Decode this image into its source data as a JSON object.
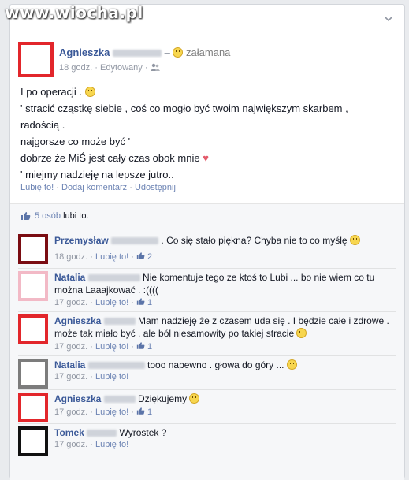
{
  "watermark": "www.wiocha.pl",
  "post": {
    "author": "Agnieszka",
    "feeling": "załamana",
    "time": "18 godz.",
    "edited": "Edytowany",
    "lines": [
      "I po operacji .",
      "' stracić cząstkę siebie , coś co mogło być twoim największym skarbem ,",
      "radością .",
      "najgorsze co może być '",
      "dobrze że MiŚ jest cały czas obok mnie",
      "' miejmy nadzieję na lepsze jutro.."
    ],
    "actions": [
      "Lubię to!",
      "Dodaj komentarz",
      "Udostępnij"
    ],
    "likes_count": "5 osób",
    "likes_suffix": "lubi to."
  },
  "comments": [
    {
      "author": "Przemysław",
      "text": ". Co się stało piękna? Chyba nie to co myślę",
      "time": "18 godz.",
      "like": "Lubię to!",
      "count": "2",
      "avatar_color": "#7a0c12"
    },
    {
      "author": "Natalia",
      "text": "Nie komentuje tego ze ktoś to Lubi ... bo nie wiem co tu można Laaajkować . :((((",
      "time": "17 godz.",
      "like": "Lubię to!",
      "count": "1",
      "avatar_color": "#f2b9c6"
    },
    {
      "author": "Agnieszka",
      "text": "Mam nadzieję że z czasem uda się . I będzie całe i zdrowe . może tak miało być , ale ból niesamowity po takiej stracie",
      "time": "17 godz.",
      "like": "Lubię to!",
      "count": "1",
      "avatar_color": "#e2262b"
    },
    {
      "author": "Natalia",
      "text": "tooo napewno . głowa do góry ...",
      "time": "17 godz.",
      "like": "Lubię to!",
      "count": "",
      "avatar_color": "#7c7c7c"
    },
    {
      "author": "Agnieszka",
      "text": "Dziękujemy",
      "time": "17 godz.",
      "like": "Lubię to!",
      "count": "1",
      "avatar_color": "#e2262b"
    },
    {
      "author": "Tomek",
      "text": "Wyrostek ?",
      "time": "17 godz.",
      "like": "Lubię to!",
      "count": "",
      "avatar_color": "#111111"
    }
  ]
}
